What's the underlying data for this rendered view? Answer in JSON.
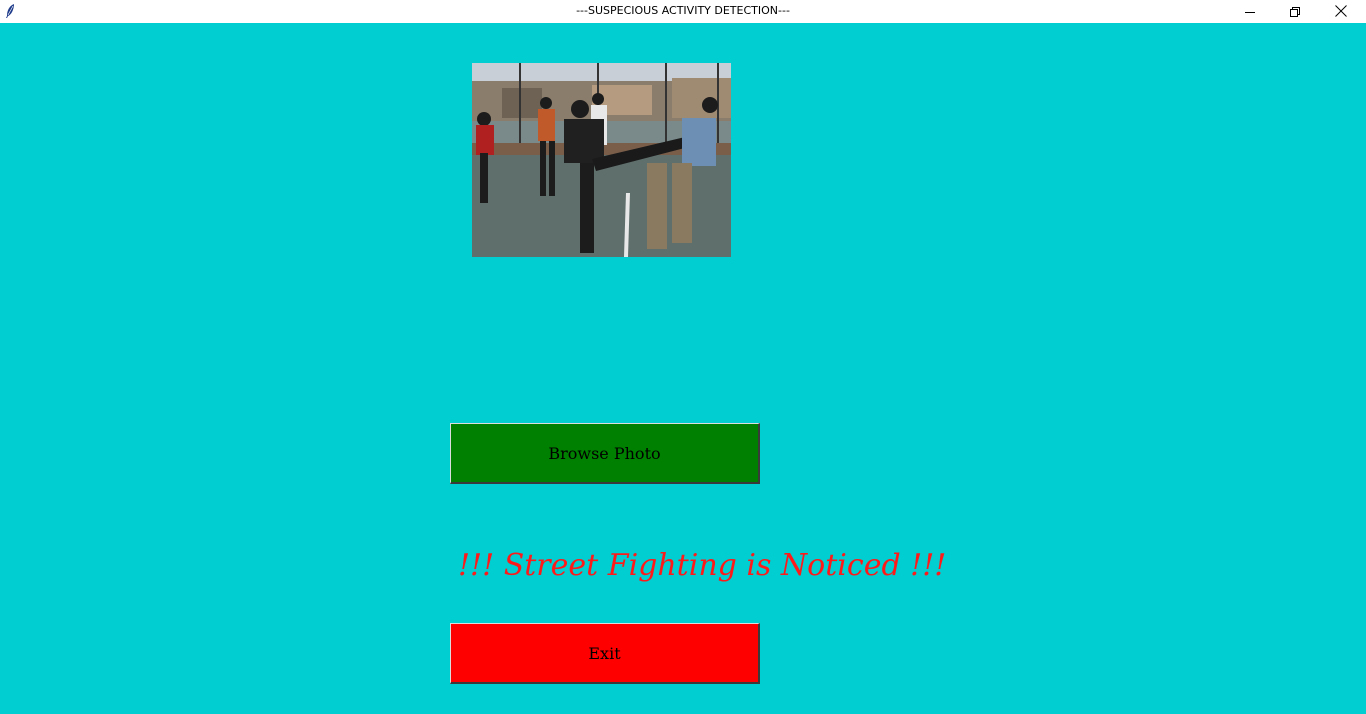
{
  "window": {
    "title": "---SUSPECIOUS ACTIVITY DETECTION---",
    "background_color": "#00CED1",
    "icons": {
      "app": "feather-icon",
      "minimize": "minimize-icon",
      "restore": "restore-icon",
      "close": "close-icon"
    }
  },
  "image": {
    "description_icon": "photo-preview",
    "alt": "Street Fighting"
  },
  "buttons": {
    "browse_label": "Browse Photo",
    "browse_color": "#008000",
    "exit_label": "Exit",
    "exit_color": "#FF0000"
  },
  "result": {
    "text": "!!! Street Fighting is Noticed !!!",
    "color": "#FF0000"
  }
}
